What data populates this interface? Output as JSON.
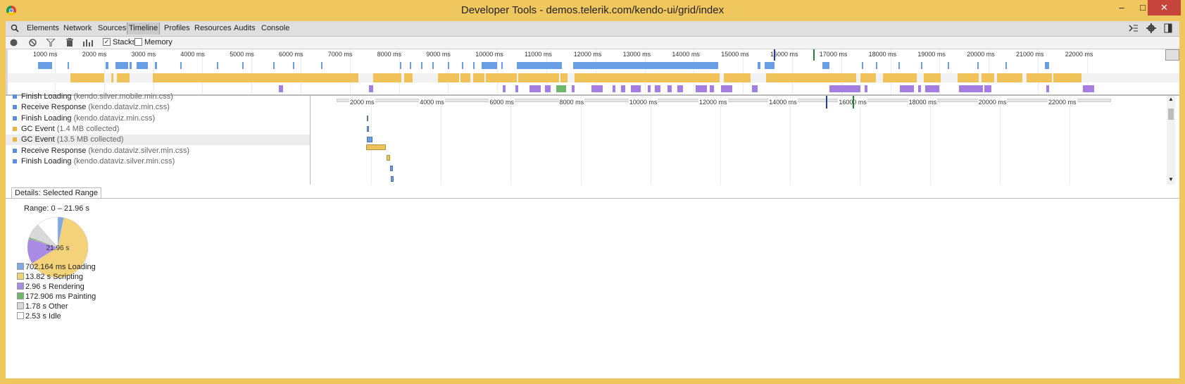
{
  "window": {
    "title": "Developer Tools - demos.telerik.com/kendo-ui/grid/index",
    "minimize": "–",
    "maximize": "□",
    "close": "✕"
  },
  "tabs": [
    "Elements",
    "Network",
    "Sources",
    "Timeline",
    "Profiles",
    "Resources",
    "Audits",
    "Console"
  ],
  "active_tab": "Timeline",
  "toolbar": {
    "stacks_label": "Stacks",
    "stacks_checked": true,
    "memory_label": "Memory",
    "memory_checked": false
  },
  "overview_ruler": [
    "1000 ms",
    "2000 ms",
    "3000 ms",
    "4000 ms",
    "5000 ms",
    "6000 ms",
    "7000 ms",
    "8000 ms",
    "9000 ms",
    "10000 ms",
    "11000 ms",
    "12000 ms",
    "13000 ms",
    "14000 ms",
    "15000 ms",
    "16000 ms",
    "17000 ms",
    "18000 ms",
    "19000 ms",
    "20000 ms",
    "21000 ms",
    "22000 ms"
  ],
  "detail_ruler": [
    "2000 ms",
    "4000 ms",
    "6000 ms",
    "8000 ms",
    "10000 ms",
    "12000 ms",
    "14000 ms",
    "16000 ms",
    "18000 ms",
    "20000 ms",
    "22000 ms"
  ],
  "records": [
    {
      "name": "Finish Loading",
      "detail": "(kendo.silver.mobile.min.css)",
      "color": "#5b8fd8"
    },
    {
      "name": "Receive Response",
      "detail": "(kendo.dataviz.min.css)",
      "color": "#5b8fd8"
    },
    {
      "name": "Finish Loading",
      "detail": "(kendo.dataviz.min.css)",
      "color": "#5b8fd8"
    },
    {
      "name": "GC Event",
      "detail": "(1.4 MB collected)",
      "color": "#e8b440"
    },
    {
      "name": "GC Event",
      "detail": "(13.5 MB collected)",
      "color": "#e8b440"
    },
    {
      "name": "Receive Response",
      "detail": "(kendo.dataviz.silver.min.css)",
      "color": "#5b8fd8"
    },
    {
      "name": "Finish Loading",
      "detail": "(kendo.dataviz.silver.min.css)",
      "color": "#5b8fd8"
    }
  ],
  "details": {
    "tab_label": "Details: Selected Range",
    "range": "Range: 0 – 21.96 s",
    "pie_label": "21.96 s",
    "legend": [
      {
        "label": "702.164 ms Loading",
        "color": "#7fa9e6"
      },
      {
        "label": "13.82 s Scripting",
        "color": "#f4d27a"
      },
      {
        "label": "2.96 s Rendering",
        "color": "#a98be6"
      },
      {
        "label": "172.906 ms Painting",
        "color": "#6fb86a"
      },
      {
        "label": "1.78 s Other",
        "color": "#d9d9d9"
      },
      {
        "label": "2.53 s Idle",
        "color": "#ffffff"
      }
    ],
    "pie_values": [
      0.702,
      13.82,
      2.96,
      0.173,
      1.78,
      2.53
    ]
  }
}
